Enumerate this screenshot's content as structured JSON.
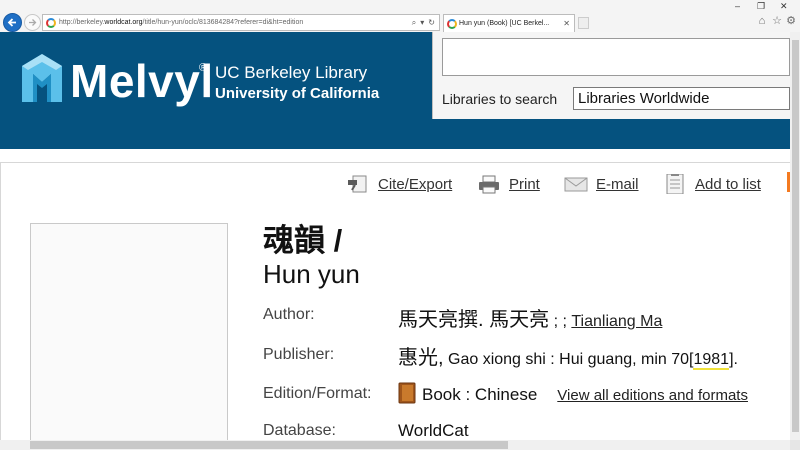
{
  "browser": {
    "url_prefix": "http://berkeley.",
    "url_domain": "worldcat.org",
    "url_path": "/title/hun-yun/oclc/813684284?referer=di&ht=edition",
    "tab_title": "Hun yun (Book) [UC Berkel...",
    "icons": {
      "back": "back-arrow-icon",
      "forward": "forward-arrow-icon",
      "search": "search-icon",
      "refresh": "refresh-icon",
      "home": "home-icon",
      "favorites": "star-icon",
      "settings": "gear-icon"
    }
  },
  "header": {
    "logo_name": "Melvyl",
    "logo_registered": "®",
    "logo_line1": "UC Berkeley Library",
    "logo_line2": "University of California",
    "search_value": "",
    "libraries_label": "Libraries to search",
    "libraries_selected": "Libraries Worldwide"
  },
  "actions": [
    {
      "label": "Cite/Export",
      "icon": "cite-export-icon"
    },
    {
      "label": "Print",
      "icon": "printer-icon"
    },
    {
      "label": "E-mail",
      "icon": "email-icon"
    },
    {
      "label": "Add to list",
      "icon": "list-icon"
    }
  ],
  "record": {
    "title_cjk": "魂韻 /",
    "title_roman": "Hun yun",
    "fields": {
      "author_label": "Author:",
      "author_cjk": "馬天亮撰. 馬天亮",
      "author_sep": " ; ; ",
      "author_link": "Tianliang Ma",
      "publisher_label": "Publisher:",
      "publisher_cjk": "惠光,",
      "publisher_text": " Gao xiong shi : Hui guang, min 70[",
      "publisher_year": "1981",
      "publisher_end": "].",
      "edition_label": "Edition/Format:",
      "edition_value": "Book : Chinese",
      "edition_link": "View all editions and formats",
      "database_label": "Database:",
      "database_value": "WorldCat"
    }
  },
  "colors": {
    "banner": "#05527f",
    "accent_orange": "#f47a20",
    "highlight": "#f0e23a"
  }
}
